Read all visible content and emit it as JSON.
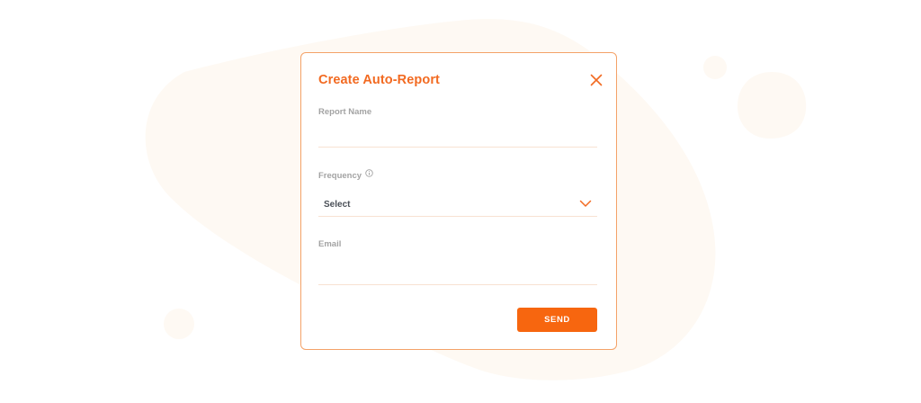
{
  "colors": {
    "accent": "#f26a21",
    "button": "#f7660f",
    "blob": "#fef9f3",
    "border": "#f4a268",
    "label": "#a3a3a3",
    "field_underline": "#f8e2d2"
  },
  "modal": {
    "title": "Create Auto-Report",
    "close_icon": "close-x-icon",
    "fields": {
      "report_name": {
        "label": "Report Name",
        "value": "",
        "placeholder": ""
      },
      "frequency": {
        "label": "Frequency",
        "info_icon": "info-icon",
        "selected": "Select",
        "chevron_icon": "chevron-down-icon"
      },
      "email": {
        "label": "Email",
        "value": "",
        "placeholder": ""
      }
    },
    "send_label": "SEND"
  }
}
